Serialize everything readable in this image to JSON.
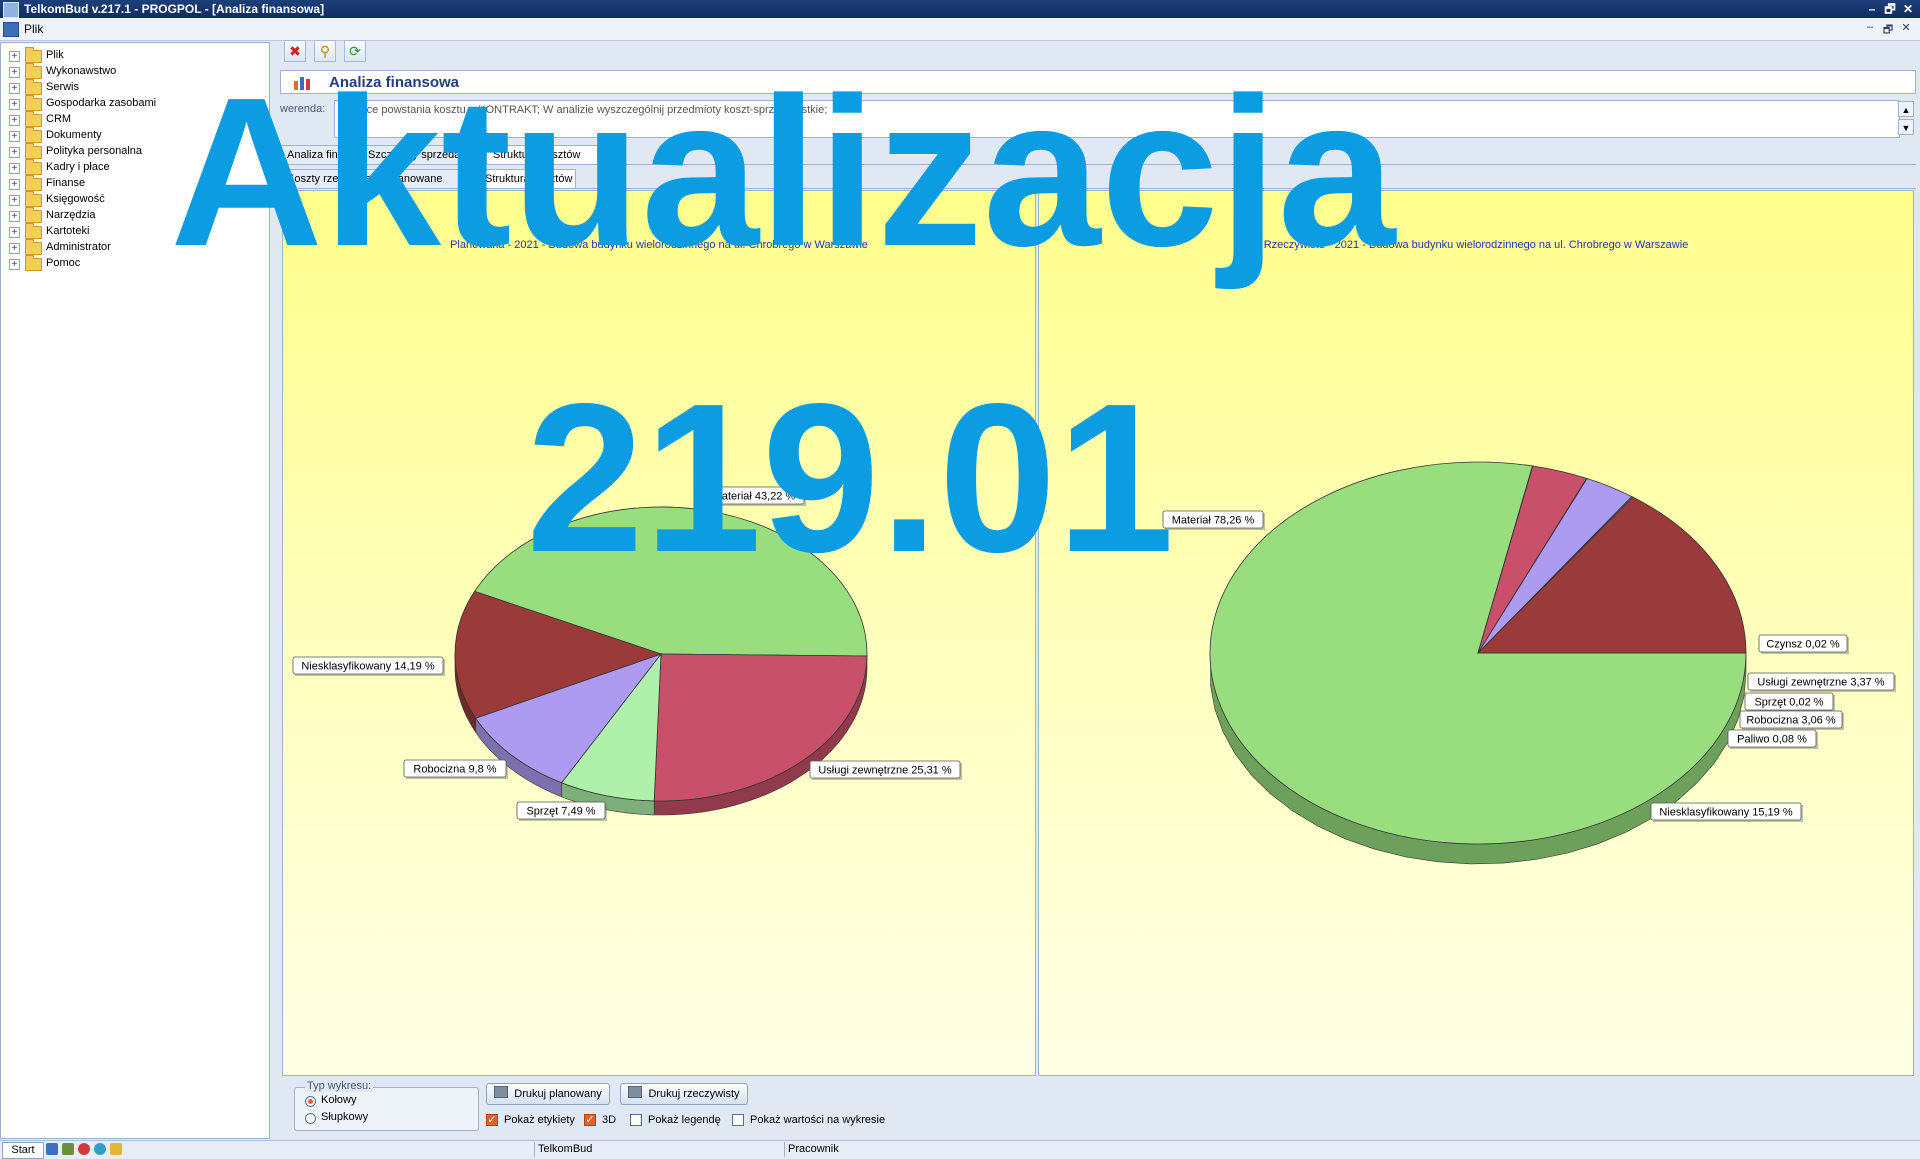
{
  "window": {
    "title": "TelkomBud v.217.1 - PROGPOL - [Analiza finansowa]",
    "buttons": [
      "–",
      "🗗",
      "✕"
    ],
    "mdi_buttons": [
      "–",
      "🗗",
      "✕"
    ]
  },
  "menu": {
    "plik": "Plik"
  },
  "tree": {
    "expander": "+",
    "items": [
      {
        "label": "Plik"
      },
      {
        "label": "Wykonawstwo"
      },
      {
        "label": "Serwis"
      },
      {
        "label": "Gospodarka zasobami"
      },
      {
        "label": "CRM"
      },
      {
        "label": "Dokumenty"
      },
      {
        "label": "Polityka personalna"
      },
      {
        "label": "Kadry i płace"
      },
      {
        "label": "Finanse"
      },
      {
        "label": "Księgowość"
      },
      {
        "label": "Narzędzia"
      },
      {
        "label": "Kartoteki"
      },
      {
        "label": "Administrator"
      },
      {
        "label": "Pomoc"
      }
    ]
  },
  "header": {
    "title": "Analiza finansowa"
  },
  "filter": {
    "label": "werenda:",
    "text": "Miejsce powstania kosztu = KONTRAKT; W analizie wyszczególnij przedmioty koszt-sprz wszystkie;",
    "spin_up": "▲",
    "spin_down": "▼"
  },
  "tabs_row1": [
    "Analiza finansowa",
    "Szczegóły sprzedaży",
    "Struktura kosztów"
  ],
  "tabs_row2": [
    "Koszty rzeczywiste",
    "Planowane",
    "Struktura kosztów"
  ],
  "charts": {
    "left_title": "Planowana - 2021 - Budowa budynku wielorodzinnego na ul. Chrobrego w Warszawie",
    "right_title": "Rzeczywiste - 2021 - Budowa budynku wielorodzinnego na ul. Chrobrego w Warszawie"
  },
  "chart_data": [
    {
      "type": "pie",
      "title": "Planowana - 2021 - Budowa budynku wielorodzinnego na ul. Chrobrego w Warszawie",
      "three_d": true,
      "slices": [
        {
          "label": "Materiał",
          "value": 43.22,
          "text": "Materiał 43,22 %",
          "color": "#98de7e"
        },
        {
          "label": "Usługi zewnętrzne",
          "value": 25.31,
          "text": "Usługi zewnętrzne 25,31 %",
          "color": "#c9506a"
        },
        {
          "label": "Sprzęt",
          "value": 7.49,
          "text": "Sprzęt 7,49 %",
          "color": "#aff1aa"
        },
        {
          "label": "Robocizna",
          "value": 9.8,
          "text": "Robocizna 9,8 %",
          "color": "#ad9bf1"
        },
        {
          "label": "Niesklasyfikowany",
          "value": 14.19,
          "text": "Niesklasyfikowany 14,19 %",
          "color": "#9a3a3a"
        }
      ]
    },
    {
      "type": "pie",
      "title": "Rzeczywiste - 2021 - Budowa budynku wielorodzinnego na ul. Chrobrego w Warszawie",
      "three_d": true,
      "slices": [
        {
          "label": "Materiał",
          "value": 78.26,
          "text": "Materiał 78,26 %",
          "color": "#98de7e"
        },
        {
          "label": "Czynsz",
          "value": 0.02,
          "text": "Czynsz 0,02 %",
          "color": "#c9506a"
        },
        {
          "label": "Usługi zewnętrzne",
          "value": 3.37,
          "text": "Usługi zewnętrzne 3,37 %",
          "color": "#c9506a"
        },
        {
          "label": "Sprzęt",
          "value": 0.02,
          "text": "Sprzęt 0,02 %",
          "color": "#aff1aa"
        },
        {
          "label": "Robocizna",
          "value": 3.06,
          "text": "Robocizna 3,06 %",
          "color": "#ad9bf1"
        },
        {
          "label": "Paliwo",
          "value": 0.08,
          "text": "Paliwo 0,08 %",
          "color": "#8ba4de"
        },
        {
          "label": "Niesklasyfikowany",
          "value": 15.19,
          "text": "Niesklasyfikowany 15,19 %",
          "color": "#9a3a3a"
        }
      ]
    }
  ],
  "controls": {
    "type_legend": "Typ wykresu:",
    "radio_pie": "Kołowy",
    "radio_bar": "Słupkowy",
    "selected": "Kołowy",
    "print_planned": "Drukuj planowany",
    "print_actual": "Drukuj rzeczywisty",
    "show_labels": "Pokaż etykiety",
    "show_labels_checked": true,
    "three_d": "3D",
    "three_d_checked": true,
    "show_legend": "Pokaż legendę",
    "show_legend_checked": false,
    "show_values": "Pokaż wartości na wykresie",
    "show_values_checked": false
  },
  "status": {
    "start": "Start",
    "app": "TelkomBud",
    "user": "Pracownik"
  },
  "overlay": {
    "line1": "Aktualizacja",
    "line2": "219.01"
  },
  "colors": {
    "overlay": "#0b9ce1",
    "title_bar": "#1d3f7a",
    "chart_bg_top": "#ffff8d"
  }
}
